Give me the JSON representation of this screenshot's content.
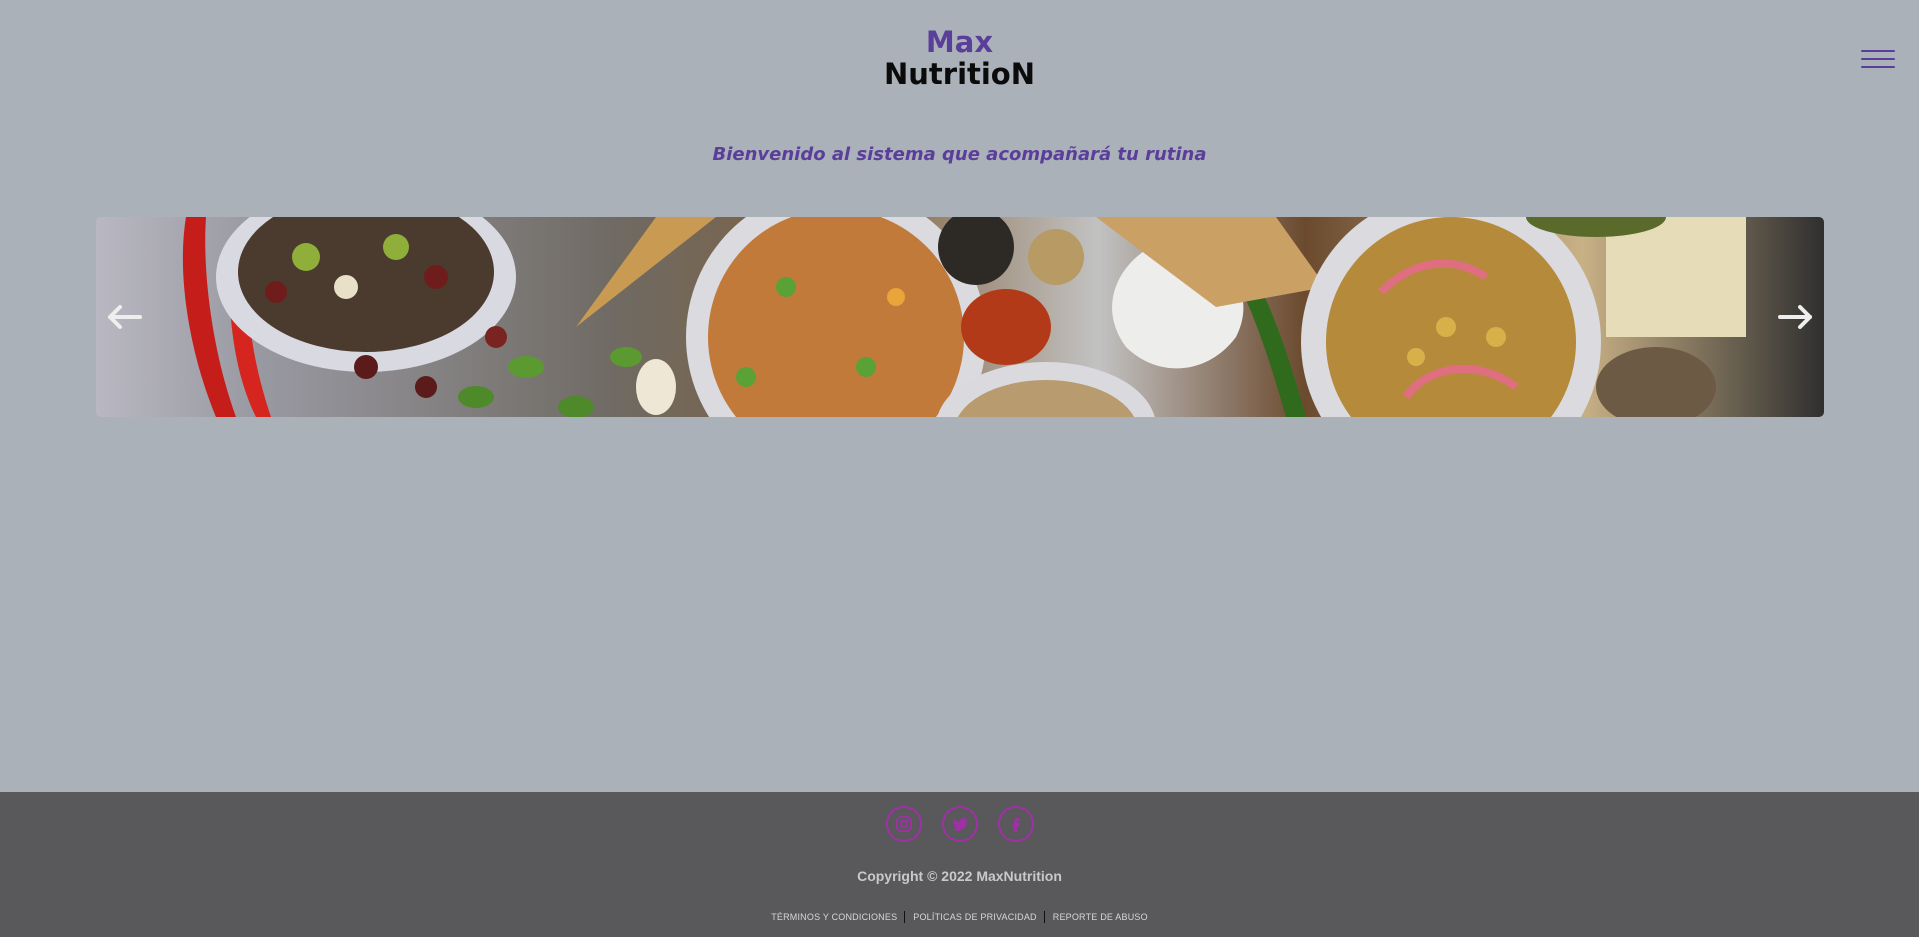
{
  "header": {
    "brand_line1": "Max",
    "brand_line2": "NutritioN",
    "menu_icon": "hamburger-menu-icon"
  },
  "welcome": {
    "text": "Bienvenido al sistema que acompañará tu rutina"
  },
  "carousel": {
    "prev_icon": "arrow-left-icon",
    "next_icon": "arrow-right-icon",
    "image_subject": "food-bowls-spices"
  },
  "footer": {
    "social": [
      {
        "name": "instagram-icon"
      },
      {
        "name": "twitter-icon"
      },
      {
        "name": "facebook-icon"
      }
    ],
    "copyright": "Copyright © 2022 MaxNutrition",
    "links": [
      {
        "label": "TÉRMINOS Y CONDICIONES"
      },
      {
        "label": "POLÍTICAS DE PRIVACIDAD"
      },
      {
        "label": "REPORTE DE ABUSO"
      }
    ]
  },
  "colors": {
    "background": "#aab1b9",
    "brand_purple": "#5b3e9a",
    "footer_bg": "#59595b",
    "social_magenta": "#a12fa8"
  }
}
